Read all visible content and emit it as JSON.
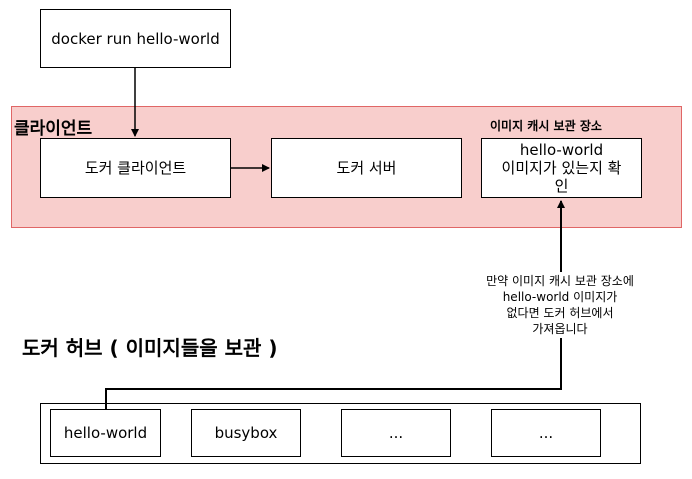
{
  "command": {
    "label": "docker run hello-world"
  },
  "client_group": {
    "label": "클라이언트",
    "docker_client": "도커 클라이언트",
    "docker_server": "도커 서버",
    "cache": {
      "label": "이미지 캐시 보관 장소",
      "check_line1": "hello-world",
      "check_line2": "이미지가 있는지 확",
      "check_line3": "인"
    }
  },
  "note": {
    "line1": "만약 이미지 캐시 보관 장소에",
    "line2": "hello-world 이미지가",
    "line3": "없다면 도커 허브에서",
    "line4": "가져옵니다"
  },
  "hub": {
    "label": "도커 허브 ( 이미지들을 보관 )",
    "images": [
      "hello-world",
      "busybox",
      "...",
      "..."
    ]
  },
  "colors": {
    "client_fill": "#f8cecc",
    "client_border": "#e06666",
    "stroke": "#000000"
  }
}
